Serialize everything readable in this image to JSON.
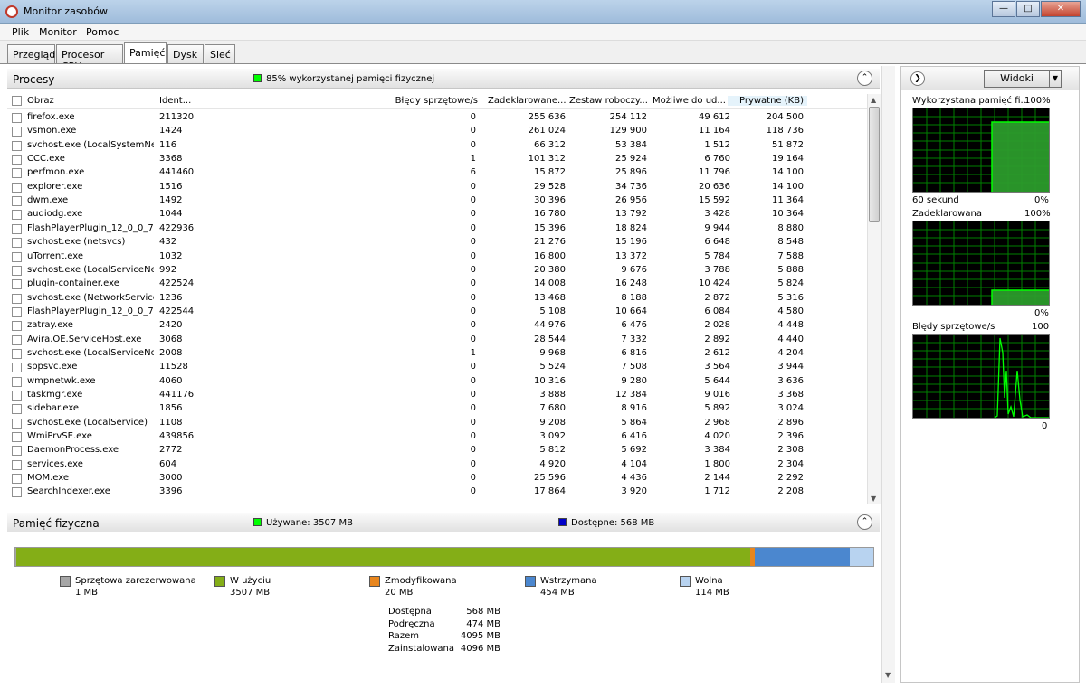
{
  "window": {
    "title": "Monitor zasobów"
  },
  "menu": [
    "Plik",
    "Monitor",
    "Pomoc"
  ],
  "tabs": [
    "Przegląd",
    "Procesor CPU",
    "Pamięć",
    "Dysk",
    "Sieć"
  ],
  "active_tab": 2,
  "processes": {
    "title": "Procesy",
    "usage_note": "85% wykorzystanej pamięci fizycznej",
    "columns": [
      "Obraz",
      "Ident...",
      "Błędy sprzętowe/s",
      "Zadeklarowane...",
      "Zestaw roboczy...",
      "Możliwe do ud...",
      "Prywatne (KB)"
    ],
    "rows": [
      [
        "firefox.exe",
        "211320",
        "0",
        "255 636",
        "254 112",
        "49 612",
        "204 500"
      ],
      [
        "vsmon.exe",
        "1424",
        "0",
        "261 024",
        "129 900",
        "11 164",
        "118 736"
      ],
      [
        "svchost.exe (LocalSystemNet...",
        "116",
        "0",
        "66 312",
        "53 384",
        "1 512",
        "51 872"
      ],
      [
        "CCC.exe",
        "3368",
        "1",
        "101 312",
        "25 924",
        "6 760",
        "19 164"
      ],
      [
        "perfmon.exe",
        "441460",
        "6",
        "15 872",
        "25 896",
        "11 796",
        "14 100"
      ],
      [
        "explorer.exe",
        "1516",
        "0",
        "29 528",
        "34 736",
        "20 636",
        "14 100"
      ],
      [
        "dwm.exe",
        "1492",
        "0",
        "30 396",
        "26 956",
        "15 592",
        "11 364"
      ],
      [
        "audiodg.exe",
        "1044",
        "0",
        "16 780",
        "13 792",
        "3 428",
        "10 364"
      ],
      [
        "FlashPlayerPlugin_12_0_0_7...",
        "422936",
        "0",
        "15 396",
        "18 824",
        "9 944",
        "8 880"
      ],
      [
        "svchost.exe (netsvcs)",
        "432",
        "0",
        "21 276",
        "15 196",
        "6 648",
        "8 548"
      ],
      [
        "uTorrent.exe",
        "1032",
        "0",
        "16 800",
        "13 372",
        "5 784",
        "7 588"
      ],
      [
        "svchost.exe (LocalServiceNet...",
        "992",
        "0",
        "20 380",
        "9 676",
        "3 788",
        "5 888"
      ],
      [
        "plugin-container.exe",
        "422524",
        "0",
        "14 008",
        "16 248",
        "10 424",
        "5 824"
      ],
      [
        "svchost.exe (NetworkService)",
        "1236",
        "0",
        "13 468",
        "8 188",
        "2 872",
        "5 316"
      ],
      [
        "FlashPlayerPlugin_12_0_0_7...",
        "422544",
        "0",
        "5 108",
        "10 664",
        "6 084",
        "4 580"
      ],
      [
        "zatray.exe",
        "2420",
        "0",
        "44 976",
        "6 476",
        "2 028",
        "4 448"
      ],
      [
        "Avira.OE.ServiceHost.exe",
        "3068",
        "0",
        "28 544",
        "7 332",
        "2 892",
        "4 440"
      ],
      [
        "svchost.exe (LocalServiceNo...",
        "2008",
        "1",
        "9 968",
        "6 816",
        "2 612",
        "4 204"
      ],
      [
        "sppsvc.exe",
        "11528",
        "0",
        "5 524",
        "7 508",
        "3 564",
        "3 944"
      ],
      [
        "wmpnetwk.exe",
        "4060",
        "0",
        "10 316",
        "9 280",
        "5 644",
        "3 636"
      ],
      [
        "taskmgr.exe",
        "441176",
        "0",
        "3 888",
        "12 384",
        "9 016",
        "3 368"
      ],
      [
        "sidebar.exe",
        "1856",
        "0",
        "7 680",
        "8 916",
        "5 892",
        "3 024"
      ],
      [
        "svchost.exe (LocalService)",
        "1108",
        "0",
        "9 208",
        "5 864",
        "2 968",
        "2 896"
      ],
      [
        "WmiPrvSE.exe",
        "439856",
        "0",
        "3 092",
        "6 416",
        "4 020",
        "2 396"
      ],
      [
        "DaemonProcess.exe",
        "2772",
        "0",
        "5 812",
        "5 692",
        "3 384",
        "2 308"
      ],
      [
        "services.exe",
        "604",
        "0",
        "4 920",
        "4 104",
        "1 800",
        "2 304"
      ],
      [
        "MOM.exe",
        "3000",
        "0",
        "25 596",
        "4 436",
        "2 144",
        "2 292"
      ],
      [
        "SearchIndexer.exe",
        "3396",
        "0",
        "17 864",
        "3 920",
        "1 712",
        "2 208"
      ]
    ]
  },
  "physical": {
    "title": "Pamięć fizyczna",
    "used_label": "Używane: 3507 MB",
    "avail_label": "Dostępne: 568 MB",
    "segments": [
      {
        "name": "Sprzętowa zarezerwowana",
        "value": "1 MB",
        "mb": 1,
        "color": "#a6a6a6"
      },
      {
        "name": "W użyciu",
        "value": "3507 MB",
        "mb": 3507,
        "color": "#84ae17"
      },
      {
        "name": "Zmodyfikowana",
        "value": "20 MB",
        "mb": 20,
        "color": "#e8861e"
      },
      {
        "name": "Wstrzymana",
        "value": "454 MB",
        "mb": 454,
        "color": "#4b87cf"
      },
      {
        "name": "Wolna",
        "value": "114 MB",
        "mb": 114,
        "color": "#b8d3f0"
      }
    ],
    "stats": [
      {
        "label": "Dostępna",
        "value": "568 MB"
      },
      {
        "label": "Podręczna",
        "value": "474 MB"
      },
      {
        "label": "Razem",
        "value": "4095 MB"
      },
      {
        "label": "Zainstalowana",
        "value": "4096 MB"
      }
    ]
  },
  "side": {
    "views_label": "Widoki",
    "graph1": {
      "title": "Wykorzystana pamięć fi...",
      "max": "100%",
      "footer_left": "60 sekund",
      "footer_right": "0%"
    },
    "graph2": {
      "title": "Zadeklarowana",
      "max": "100%",
      "footer_right": "0%"
    },
    "graph3": {
      "title": "Błędy sprzętowe/s",
      "max": "100",
      "footer_right": "0"
    }
  },
  "colors": {
    "accent_green": "#00ff00",
    "available_blue": "#0000c8"
  }
}
